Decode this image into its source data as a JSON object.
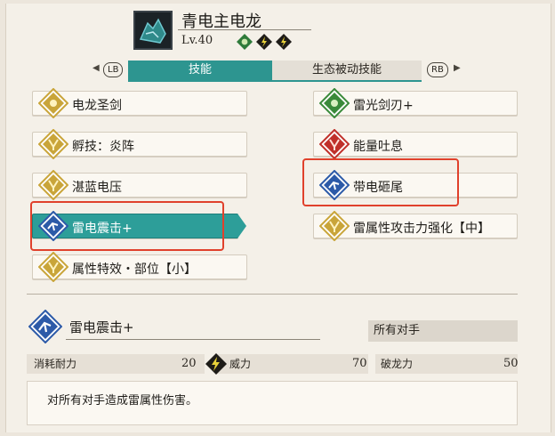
{
  "header": {
    "monster_name": "青电主电龙",
    "level": "Lv.40",
    "elements": [
      "electric-clover-icon",
      "thunder-icon",
      "thunder-icon"
    ]
  },
  "tabs": {
    "lb": "LB",
    "rb": "RB",
    "active": "技能",
    "inactive": "生态被动技能"
  },
  "skills_left": [
    {
      "label": "电龙圣剑",
      "icon": "clover-icon",
      "color": "#c9a53a"
    },
    {
      "label": "孵技：炎阵",
      "icon": "claw-icon",
      "color": "#c9a53a"
    },
    {
      "label": "湛蓝电压",
      "icon": "claw-icon",
      "color": "#c9a53a"
    },
    {
      "label": "雷电震击+",
      "icon": "kick-icon",
      "color": "#2c5aa8",
      "selected": true
    },
    {
      "label": "属性特效・部位【小】",
      "icon": "claw-icon",
      "color": "#c9a53a"
    }
  ],
  "skills_right": [
    {
      "label": "雷光剑刃+",
      "icon": "clover-icon",
      "color": "#3a8a3a"
    },
    {
      "label": "能量吐息",
      "icon": "claw-icon",
      "color": "#c0302a"
    },
    {
      "label": "带电砸尾",
      "icon": "kick-icon",
      "color": "#2c5aa8"
    },
    {
      "label": "雷属性攻击力强化【中】",
      "icon": "claw-icon",
      "color": "#c9a53a"
    }
  ],
  "detail": {
    "title": "雷电震击+",
    "target": "所有对手",
    "stamina_label": "消耗耐力",
    "stamina_value": "20",
    "power_label": "威力",
    "power_value": "70",
    "dragon_label": "破龙力",
    "dragon_value": "50",
    "description": "对所有对手造成雷属性伤害。"
  },
  "colors": {
    "accent": "#2d9e99",
    "highlight": "#e0412c",
    "gold": "#c9a53a",
    "blue": "#2c5aa8",
    "green": "#3a8a3a",
    "red": "#c0302a"
  }
}
